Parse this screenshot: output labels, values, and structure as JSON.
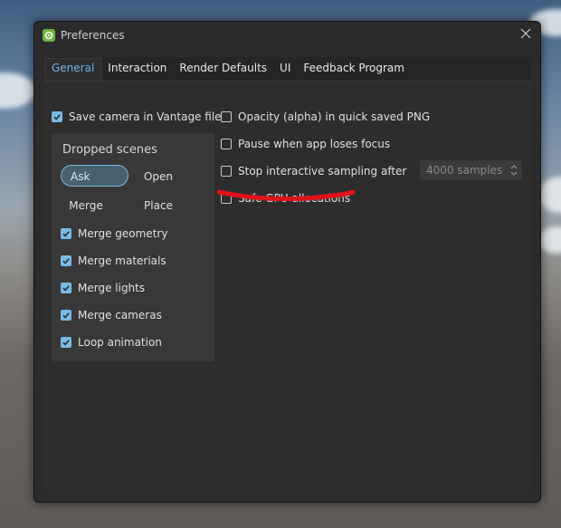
{
  "window": {
    "title": "Preferences"
  },
  "tabs": [
    {
      "label": "General",
      "active": true
    },
    {
      "label": "Interaction",
      "active": false
    },
    {
      "label": "Render Defaults",
      "active": false
    },
    {
      "label": "UI",
      "active": false
    },
    {
      "label": "Feedback Program",
      "active": false
    }
  ],
  "general": {
    "save_camera": {
      "label": "Save camera in Vantage file",
      "checked": true
    },
    "opacity_png": {
      "label": "Opacity (alpha) in quick saved PNG",
      "checked": false
    },
    "pause_focus": {
      "label": "Pause when app loses focus",
      "checked": false
    },
    "stop_sampling": {
      "label": "Stop interactive sampling after",
      "checked": false,
      "value": "4000 samples"
    },
    "safe_gpu": {
      "label": "Safe GPU allocations",
      "checked": false
    },
    "dropped_scenes": {
      "title": "Dropped scenes",
      "options": [
        "Ask",
        "Open",
        "Merge",
        "Place"
      ],
      "selected": "Ask",
      "merge_geometry": {
        "label": "Merge geometry",
        "checked": true
      },
      "merge_materials": {
        "label": "Merge materials",
        "checked": true
      },
      "merge_lights": {
        "label": "Merge lights",
        "checked": true
      },
      "merge_cameras": {
        "label": "Merge cameras",
        "checked": true
      },
      "loop_animation": {
        "label": "Loop animation",
        "checked": true
      }
    }
  },
  "colors": {
    "accent": "#7ab9e3",
    "annotation": "#e0121a",
    "logo": "#6db33f"
  }
}
